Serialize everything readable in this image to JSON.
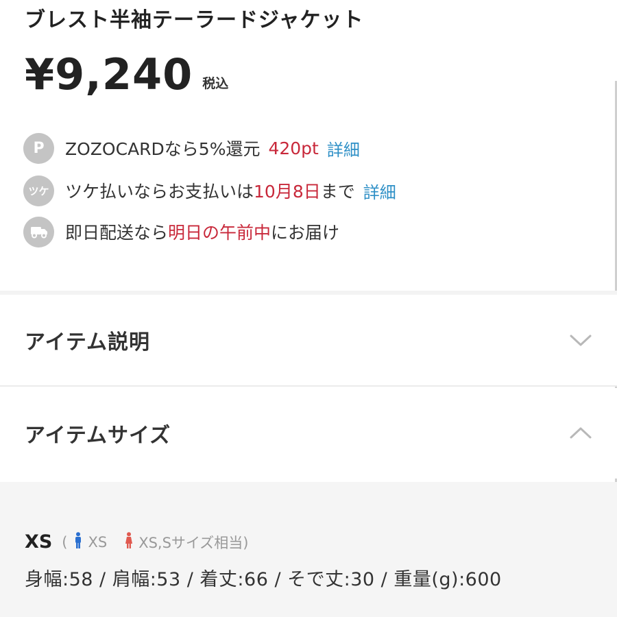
{
  "product": {
    "title": "ブレスト半袖テーラードジャケット",
    "price": "¥9,240",
    "tax_label": "税込"
  },
  "info_rows": {
    "points": {
      "icon": "P",
      "text_before": "ZOZOCARDなら5%還元",
      "highlight": "420pt",
      "link": "詳細"
    },
    "tsuke": {
      "icon": "ツケ",
      "text_before": "ツケ払いならお支払いは",
      "highlight": "10月8日",
      "text_after": "まで",
      "link": "詳細"
    },
    "delivery": {
      "icon": "truck-icon",
      "text_before": "即日配送なら",
      "highlight": "明日の午前中",
      "text_after": "にお届け"
    }
  },
  "sections": {
    "description": {
      "label": "アイテム説明",
      "expanded": false
    },
    "size": {
      "label": "アイテムサイズ",
      "expanded": true
    }
  },
  "size_table": {
    "size_name": "XS",
    "open_paren": "(",
    "male_equiv": "XS",
    "female_equiv": "XS,Sサイズ相当)",
    "detail": "身幅:58 / 肩幅:53 / 着丈:66 / そで丈:30 / 重量(g):600"
  },
  "colors": {
    "accent_red": "#c8283a",
    "link_blue": "#2d8fc6",
    "male_icon": "#2a6fd0",
    "female_icon": "#e0594f"
  }
}
